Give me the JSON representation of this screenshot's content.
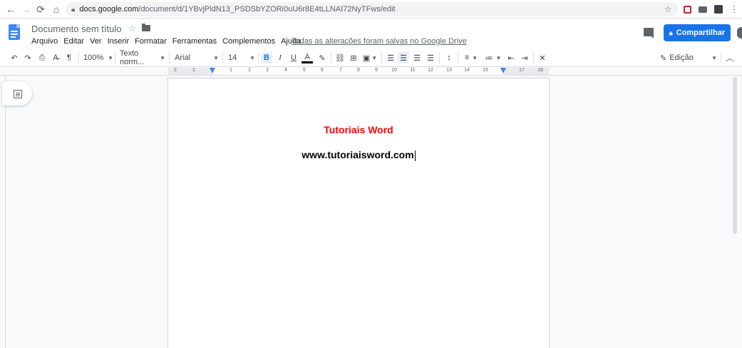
{
  "browser": {
    "url_host": "docs.google.com",
    "url_path": "/document/d/1YBvjPldN13_PSDSbYZORi0uU6r8E4tLLNAI72NyTFws/edit"
  },
  "docs": {
    "title": "Documento sem título",
    "menu": [
      "Arquivo",
      "Editar",
      "Ver",
      "Inserir",
      "Formatar",
      "Ferramentas",
      "Complementos",
      "Ajuda"
    ],
    "save_status": "Todas as alterações foram salvas no Google Drive",
    "share_label": "Compartilhar"
  },
  "toolbar": {
    "zoom": "100%",
    "style": "Texto norm...",
    "font": "Arial",
    "size": "14",
    "bold": "B",
    "italic": "I",
    "underline": "U",
    "text_color": "A",
    "mode": "Edição"
  },
  "ruler": {
    "numbers": [
      "2",
      "1",
      "1",
      "2",
      "3",
      "4",
      "5",
      "6",
      "7",
      "8",
      "9",
      "10",
      "11",
      "12",
      "13",
      "14",
      "15",
      "17",
      "18"
    ]
  },
  "document": {
    "heading": "Tutoriais Word",
    "url": "www.tutoriaisword.com"
  },
  "colors": {
    "accent": "#1a73e8",
    "heading": "#ff0000"
  }
}
